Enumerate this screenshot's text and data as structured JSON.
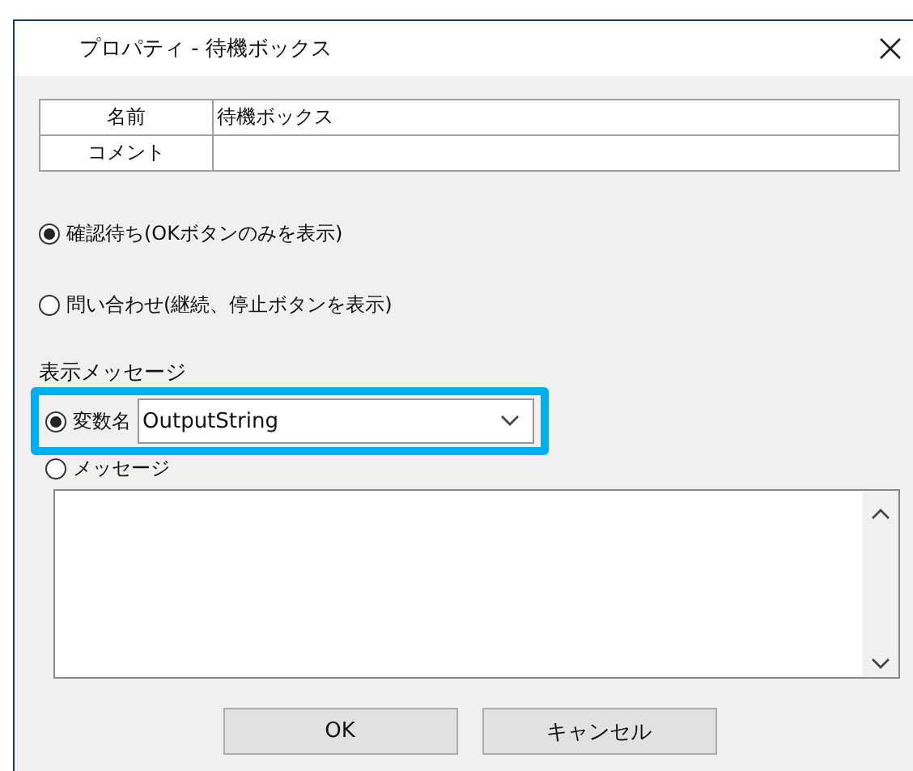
{
  "window": {
    "title": "プロパティ - 待機ボックス"
  },
  "properties": [
    {
      "label": "名前",
      "value": "待機ボックス"
    },
    {
      "label": "コメント"
    }
  ],
  "modes": [
    {
      "label": "確認待ち(OKボタンのみを表示)",
      "selected": true
    },
    {
      "label": "問い合わせ(継続、停止ボタンを表示)",
      "selected": false
    }
  ],
  "message_section": {
    "label": "表示メッセージ",
    "sources": [
      {
        "kind": "dropdown",
        "label": "変数名",
        "selected": true,
        "highlighted": true,
        "value": "OutputString"
      },
      {
        "kind": "textarea",
        "label": "メッセージ",
        "selected": false
      }
    ]
  },
  "buttons": [
    "OK",
    "キャンセル"
  ]
}
